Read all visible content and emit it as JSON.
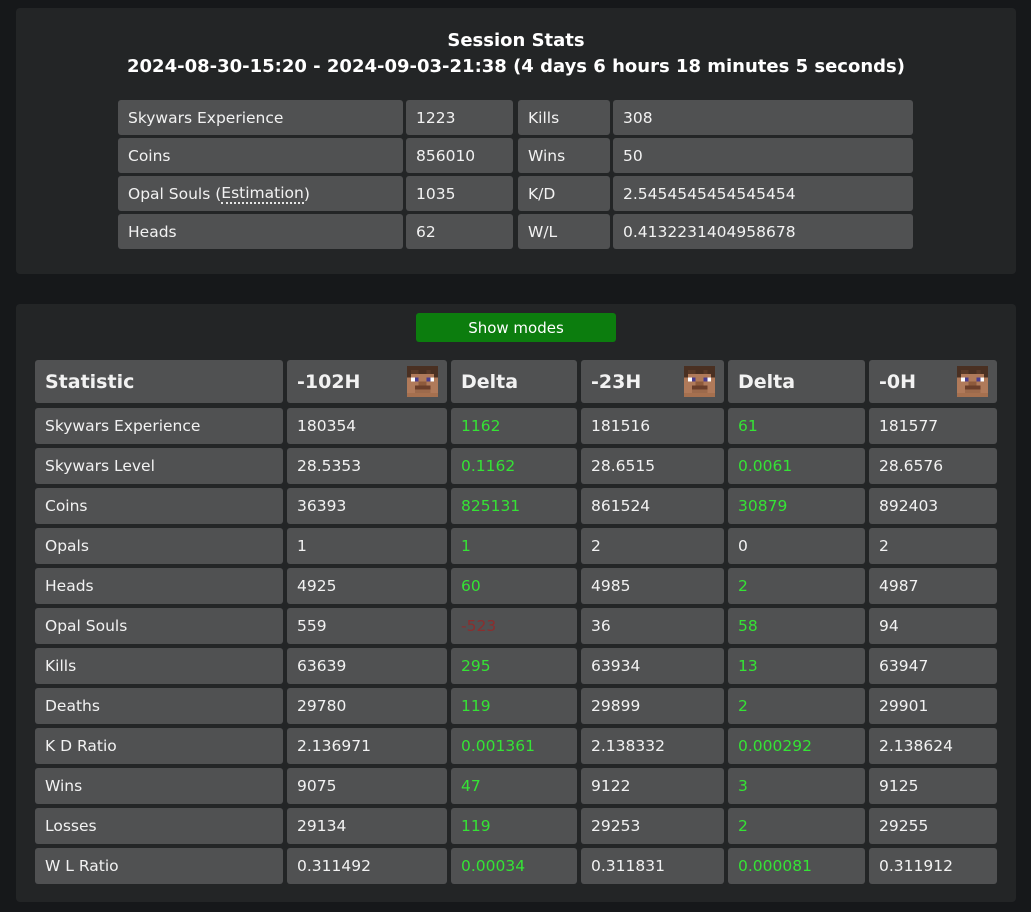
{
  "session": {
    "title": "Session Stats",
    "range": "2024-08-30-15:20 - 2024-09-03-21:38 (4 days 6 hours 18 minutes 5 seconds)",
    "left_rows": [
      {
        "label": "Skywars Experience",
        "value": "1223"
      },
      {
        "label_prefix": "Opal Souls (",
        "label_abbr": "Estimation",
        "label_suffix": ")",
        "label": "Coins",
        "value": "856010"
      },
      {
        "label": "Opal Souls (Estimation)",
        "value": "1035"
      },
      {
        "label": "Heads",
        "value": "62"
      }
    ],
    "right_rows": [
      {
        "label": "Kills",
        "value": "308"
      },
      {
        "label": "Wins",
        "value": "50"
      },
      {
        "label": "K/D",
        "value": "2.5454545454545454"
      },
      {
        "label": "W/L",
        "value": "0.4132231404958678"
      }
    ],
    "opal_label_prefix": "Opal Souls (",
    "opal_label_abbr": "Estimation",
    "opal_label_suffix": ")"
  },
  "comparison": {
    "toggle_label": "Show modes",
    "headers": [
      "Statistic",
      "-102H",
      "Delta",
      "-23H",
      "Delta",
      "-0H"
    ],
    "rows": [
      {
        "stat": "Skywars Experience",
        "h102": "180354",
        "d1": "1162",
        "h23": "181516",
        "d2": "61",
        "h0": "181577"
      },
      {
        "stat": "Skywars Level",
        "h102": "28.5353",
        "d1": "0.1162",
        "h23": "28.6515",
        "d2": "0.0061",
        "h0": "28.6576"
      },
      {
        "stat": "Coins",
        "h102": "36393",
        "d1": "825131",
        "h23": "861524",
        "d2": "30879",
        "h0": "892403"
      },
      {
        "stat": "Opals",
        "h102": "1",
        "d1": "1",
        "h23": "2",
        "d2": "0",
        "h0": "2"
      },
      {
        "stat": "Heads",
        "h102": "4925",
        "d1": "60",
        "h23": "4985",
        "d2": "2",
        "h0": "4987"
      },
      {
        "stat": "Opal Souls",
        "h102": "559",
        "d1": "-523",
        "h23": "36",
        "d2": "58",
        "h0": "94"
      },
      {
        "stat": "Kills",
        "h102": "63639",
        "d1": "295",
        "h23": "63934",
        "d2": "13",
        "h0": "63947"
      },
      {
        "stat": "Deaths",
        "h102": "29780",
        "d1": "119",
        "h23": "29899",
        "d2": "2",
        "h0": "29901"
      },
      {
        "stat": "K D Ratio",
        "h102": "2.136971",
        "d1": "0.001361",
        "h23": "2.138332",
        "d2": "0.000292",
        "h0": "2.138624"
      },
      {
        "stat": "Wins",
        "h102": "9075",
        "d1": "47",
        "h23": "9122",
        "d2": "3",
        "h0": "9125"
      },
      {
        "stat": "Losses",
        "h102": "29134",
        "d1": "119",
        "h23": "29253",
        "d2": "2",
        "h0": "29255"
      },
      {
        "stat": "W L Ratio",
        "h102": "0.311492",
        "d1": "0.00034",
        "h23": "0.311831",
        "d2": "0.000081",
        "h0": "0.311912"
      }
    ]
  },
  "colors": {
    "page_bg": "#16181a",
    "panel_bg": "#232526",
    "cell_bg": "#505152",
    "button_bg": "#0c7d0e",
    "delta_positive": "#35e335",
    "delta_negative": "#8b2e2e",
    "delta_zero": "#ffffff"
  },
  "icons": {
    "player_head": "player-head-icon"
  }
}
